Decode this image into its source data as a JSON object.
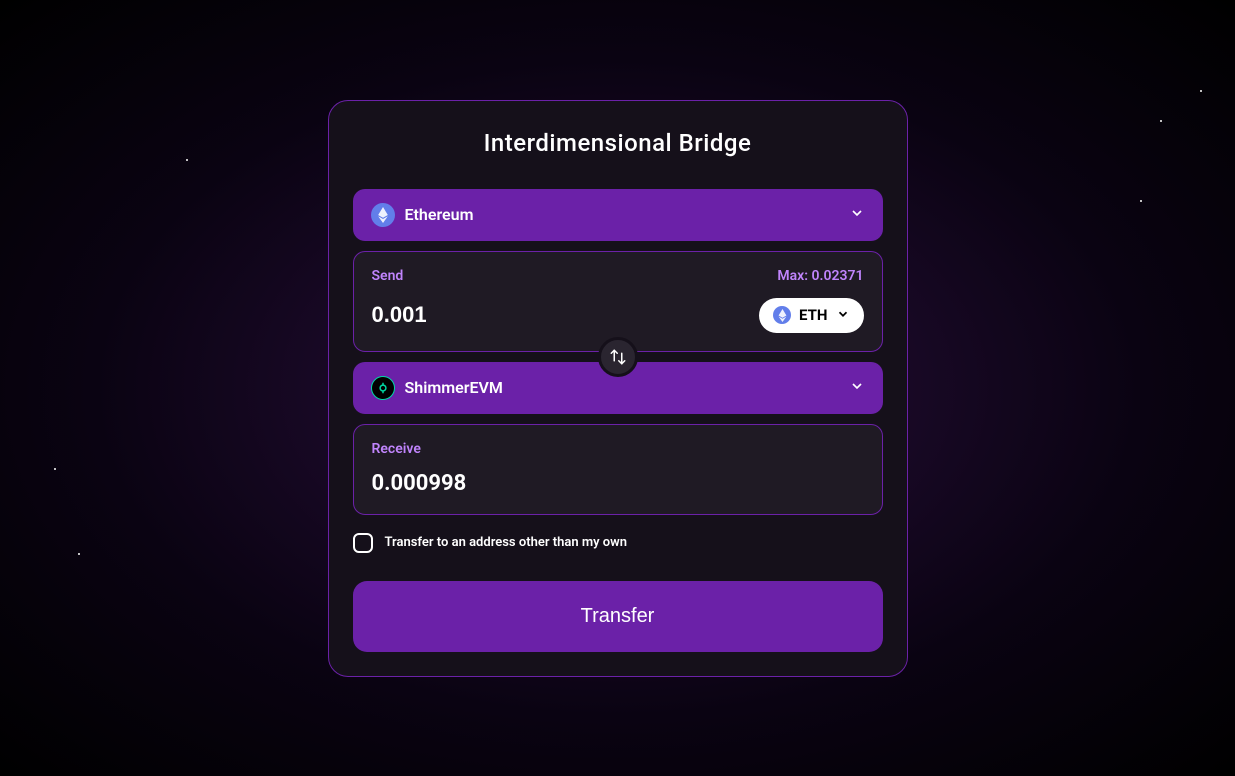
{
  "title": "Interdimensional Bridge",
  "source": {
    "chain_name": "Ethereum",
    "send_label": "Send",
    "max_label": "Max: 0.02371",
    "amount": "0.001",
    "token_symbol": "ETH"
  },
  "destination": {
    "chain_name": "ShimmerEVM",
    "receive_label": "Receive",
    "amount": "0.000998"
  },
  "other_address": {
    "label": "Transfer to an address other than my own",
    "checked": false
  },
  "transfer_button": "Transfer",
  "colors": {
    "accent": "#6b21a8",
    "panel_border": "#6b21a8",
    "label": "#c084fc",
    "eth": "#627eea",
    "shimmer": "#00d9a5"
  }
}
